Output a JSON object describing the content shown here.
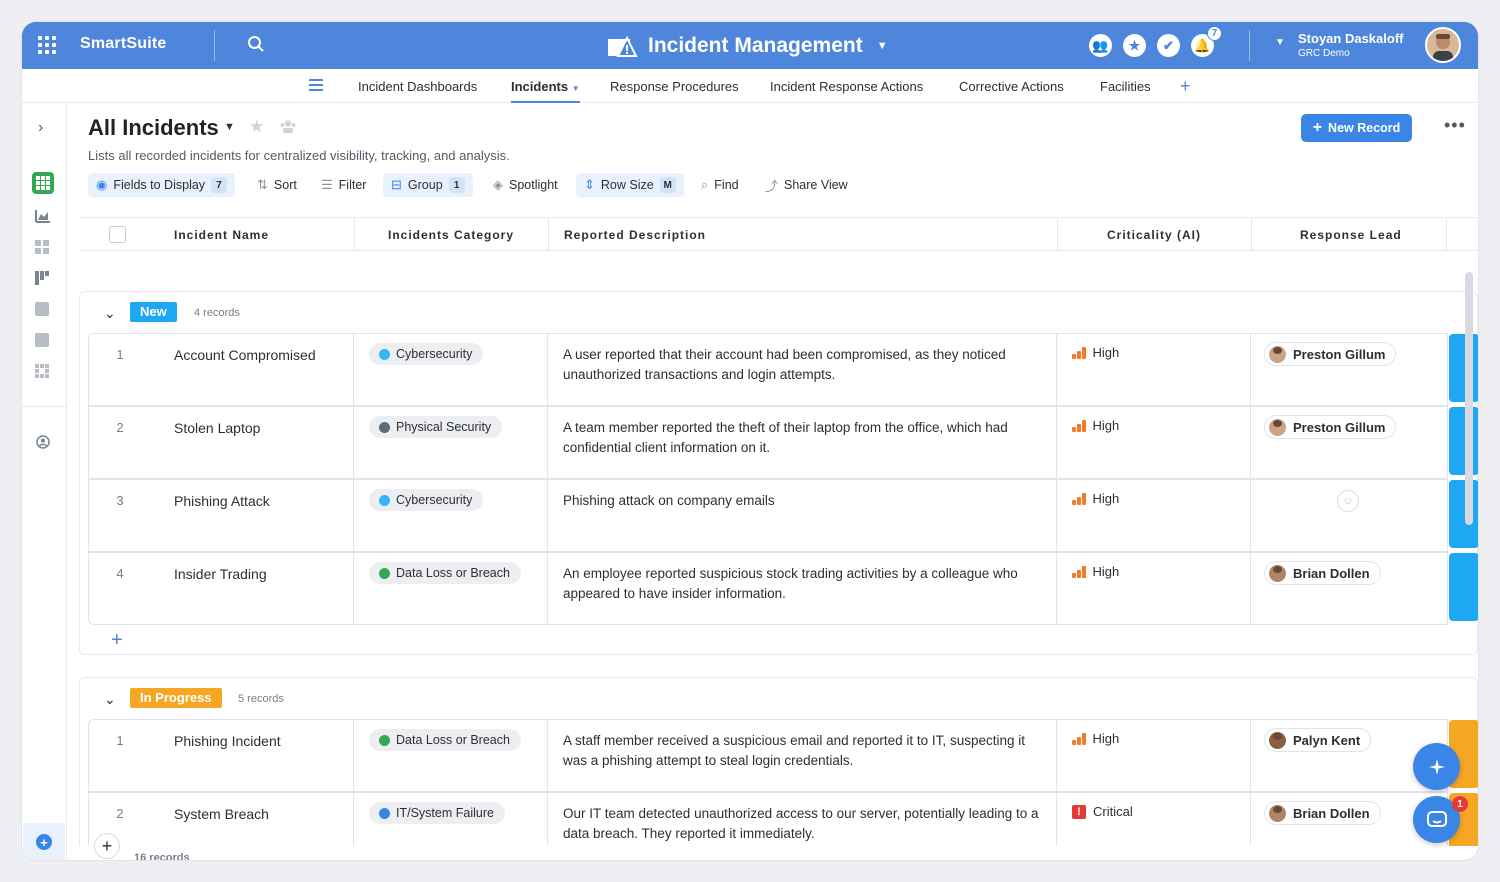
{
  "app": {
    "brand": "SmartSuite"
  },
  "solution": {
    "title": "Incident Management"
  },
  "notifications": {
    "count": "7"
  },
  "user": {
    "name": "Stoyan Daskaloff",
    "workspace": "GRC Demo"
  },
  "nav": {
    "tabs": [
      {
        "label": "Incident Dashboards"
      },
      {
        "label": "Incidents"
      },
      {
        "label": "Response Procedures"
      },
      {
        "label": "Incident Response Actions"
      },
      {
        "label": "Corrective Actions"
      },
      {
        "label": "Facilities"
      }
    ]
  },
  "view": {
    "title": "All Incidents",
    "description": "Lists all recorded incidents for centralized visibility, tracking, and analysis.",
    "new_record": "New Record"
  },
  "toolbar": {
    "fields": "Fields to Display",
    "fields_count": "7",
    "sort": "Sort",
    "filter": "Filter",
    "group": "Group",
    "group_count": "1",
    "spotlight": "Spotlight",
    "row_size": "Row Size",
    "row_size_value": "M",
    "find": "Find",
    "share": "Share View"
  },
  "columns": [
    "Incident Name",
    "Incidents Category",
    "Reported Description",
    "Criticality (AI)",
    "Response Lead"
  ],
  "groups": [
    {
      "label": "New",
      "color": "#1ea7f2",
      "count": "4 records",
      "rows": [
        {
          "num": "1",
          "name": "Account Compromised",
          "category": "Cybersecurity",
          "cat_color": "#35b6f4",
          "description": "A user reported that their account had been compromised, as they noticed unauthorized transactions and login attempts.",
          "criticality": "High",
          "lead": "Preston Gillum"
        },
        {
          "num": "2",
          "name": "Stolen Laptop",
          "category": "Physical Security",
          "cat_color": "#5d6a79",
          "description": "A team member reported the theft of their laptop from the office, which had confidential client information on it.",
          "criticality": "High",
          "lead": "Preston Gillum"
        },
        {
          "num": "3",
          "name": "Phishing Attack",
          "category": "Cybersecurity",
          "cat_color": "#35b6f4",
          "description": "Phishing attack on company emails",
          "criticality": "High",
          "lead": ""
        },
        {
          "num": "4",
          "name": "Insider Trading",
          "category": "Data Loss or Breach",
          "cat_color": "#33a852",
          "description": "An employee reported suspicious stock trading activities by a colleague who appeared to have insider information.",
          "criticality": "High",
          "lead": "Brian Dollen"
        }
      ]
    },
    {
      "label": "In Progress",
      "color": "#f5a623",
      "count": "5 records",
      "rows": [
        {
          "num": "1",
          "name": "Phishing Incident",
          "category": "Data Loss or Breach",
          "cat_color": "#33a852",
          "description": "A staff member received a suspicious email and reported it to IT, suspecting it was a phishing attempt to steal login credentials.",
          "criticality": "High",
          "lead": "Palyn Kent"
        },
        {
          "num": "2",
          "name": "System Breach",
          "category": "IT/System Failure",
          "cat_color": "#3a86e6",
          "description": "Our IT team detected unauthorized access to our server, potentially leading to a data breach. They reported it immediately.",
          "criticality": "Critical",
          "lead": "Brian Dollen"
        }
      ]
    }
  ],
  "footer": {
    "total": "16 records"
  },
  "chat": {
    "badge": "1"
  }
}
